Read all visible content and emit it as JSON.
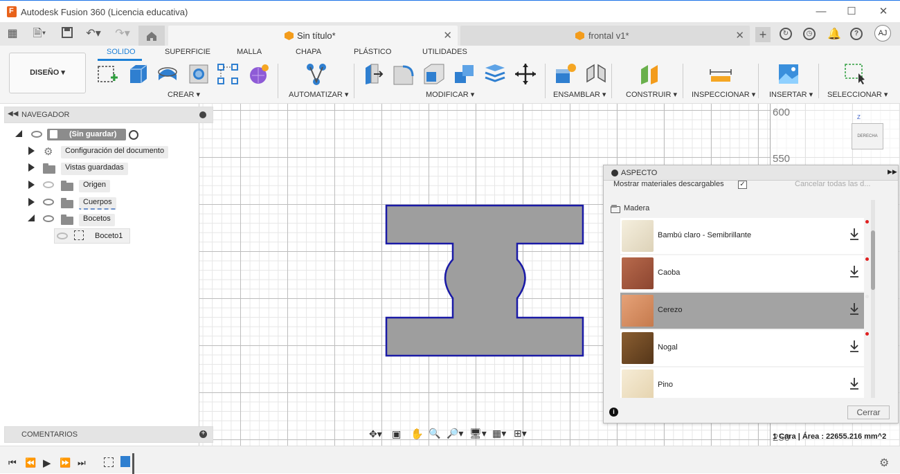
{
  "window": {
    "title": "Autodesk Fusion 360 (Licencia educativa)"
  },
  "tabs": [
    {
      "label": "Sin título*",
      "active": true
    },
    {
      "label": "frontal v1*",
      "active": false
    }
  ],
  "user": {
    "initials": "AJ"
  },
  "toolbar": {
    "design_label": "DISEÑO ▾",
    "workspace_tabs": [
      "SOLIDO",
      "SUPERFICIE",
      "MALLA",
      "CHAPA",
      "PLÁSTICO",
      "UTILIDADES"
    ],
    "groups": {
      "crear": "CREAR ▾",
      "automatizar": "AUTOMATIZAR ▾",
      "modificar": "MODIFICAR ▾",
      "ensamblar": "ENSAMBLAR ▾",
      "construir": "CONSTRUIR ▾",
      "inspeccionar": "INSPECCIONAR ▾",
      "insertar": "INSERTAR ▾",
      "seleccionar": "SELECCIONAR ▾"
    }
  },
  "navigator": {
    "title": "NAVEGADOR",
    "root": "(Sin guardar)",
    "items": [
      {
        "label": "Configuración del documento"
      },
      {
        "label": "Vistas guardadas"
      },
      {
        "label": "Origen"
      },
      {
        "label": "Cuerpos"
      },
      {
        "label": "Bocetos"
      },
      {
        "label": "Boceto1"
      }
    ]
  },
  "comments": {
    "title": "COMENTARIOS"
  },
  "viewcube": {
    "face": "DERECHA",
    "axis": "Z"
  },
  "ruler": {
    "ticks": [
      "600",
      "550",
      "250"
    ]
  },
  "aspect_panel": {
    "title": "ASPECTO",
    "show_downloadable": "Mostrar materiales descargables",
    "cancel_all": "Cancelar todas las d...",
    "category": "Madera",
    "materials": [
      {
        "name": "Bambú claro - Semibrillante",
        "color": "#efe8d6",
        "selected": false
      },
      {
        "name": "Caoba",
        "color": "#a55a3e",
        "selected": false
      },
      {
        "name": "Cerezo",
        "color": "#d99063",
        "selected": true
      },
      {
        "name": "Nogal",
        "color": "#6e4a27",
        "selected": false
      },
      {
        "name": "Pino",
        "color": "#f1e5cc",
        "selected": false
      }
    ],
    "close_label": "Cerrar"
  },
  "status": {
    "measure": "1 Cara | Área : 22655.216 mm^2"
  },
  "colors": {
    "accent": "#1b7fd6",
    "sketch_outline": "#1a1aa6",
    "profile_fill": "#9e9e9e"
  }
}
